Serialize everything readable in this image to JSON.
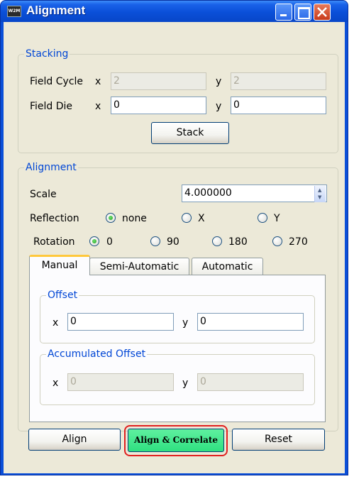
{
  "window": {
    "title": "Alignment",
    "app_icon_text": "W2M"
  },
  "stacking": {
    "legend": "Stacking",
    "field_cycle": {
      "label": "Field Cycle",
      "x_label": "x",
      "x_value": "2",
      "y_label": "y",
      "y_value": "2"
    },
    "field_die": {
      "label": "Field Die",
      "x_label": "x",
      "x_value": "0",
      "y_label": "y",
      "y_value": "0"
    },
    "stack_button": "Stack"
  },
  "alignment": {
    "legend": "Alignment",
    "scale": {
      "label": "Scale",
      "value": "4.000000"
    },
    "reflection": {
      "label": "Reflection",
      "options": [
        "none",
        "X",
        "Y"
      ],
      "selected": "none"
    },
    "rotation": {
      "label": "Rotation",
      "options": [
        "0",
        "90",
        "180",
        "270"
      ],
      "selected": "0"
    },
    "tabs": [
      "Manual",
      "Semi-Automatic",
      "Automatic"
    ],
    "active_tab": "Manual",
    "offset": {
      "legend": "Offset",
      "x_label": "x",
      "x_value": "0",
      "y_label": "y",
      "y_value": "0"
    },
    "accumulated_offset": {
      "legend": "Accumulated Offset",
      "x_label": "x",
      "x_value": "0",
      "y_label": "y",
      "y_value": "0"
    }
  },
  "buttons": {
    "align": "Align",
    "align_correlate": "Align & Correlate",
    "reset": "Reset"
  },
  "colors": {
    "title_bar": "#0a4fd8",
    "legend_text": "#0046d5",
    "highlight": "#e02020",
    "align_correlate_bg": "#3fe890"
  }
}
